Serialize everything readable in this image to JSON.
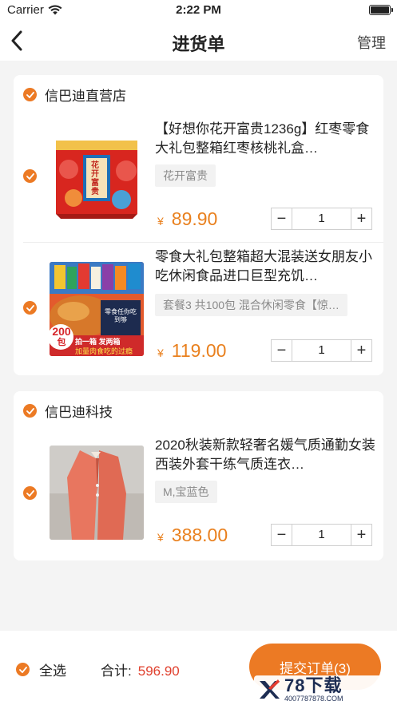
{
  "status_bar": {
    "carrier": "Carrier",
    "time": "2:22 PM"
  },
  "nav": {
    "title": "进货单",
    "manage_label": "管理"
  },
  "stores": [
    {
      "name": "信巴迪直营店",
      "items": [
        {
          "name": "【好想你花开富贵1236g】红枣零食大礼包整箱红枣核桃礼盒…",
          "sku": "花开富贵",
          "currency": "¥",
          "price": "89.90",
          "qty": "1",
          "thumb_text": "花开富贵"
        },
        {
          "name": "零食大礼包整箱超大混装送女朋友小吃休闲食品进口巨型充饥…",
          "sku": "套餐3 共100包 混合休闲零食【惊…",
          "currency": "¥",
          "price": "119.00",
          "qty": "1",
          "thumb_badge": "200",
          "thumb_badge_unit": "包",
          "thumb_line1": "拍一箱 发两箱",
          "thumb_line2": "加量肉食吃的过瘾",
          "thumb_box_text": "零食任你吃到够"
        }
      ]
    },
    {
      "name": "信巴迪科技",
      "items": [
        {
          "name": "2020秋装新款轻奢名媛气质通勤女装西装外套干练气质连衣…",
          "sku": "M,宝蓝色",
          "currency": "¥",
          "price": "388.00",
          "qty": "1"
        }
      ]
    }
  ],
  "bottom": {
    "select_all": "全选",
    "total_label": "合计:",
    "total_value": "596.90",
    "submit_label": "提交订单(3)"
  },
  "watermark": {
    "main": "78下载",
    "sub": "4007787878.COM"
  },
  "colors": {
    "accent": "#ec7a24",
    "price": "#e9801e",
    "total": "#e0402e"
  }
}
